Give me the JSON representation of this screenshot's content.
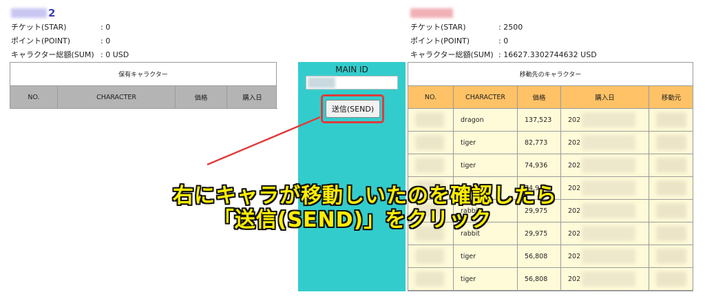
{
  "left_account": {
    "name_suffix": "2",
    "rows": [
      {
        "label": "チケット(STAR)",
        "value": ": 0"
      },
      {
        "label": "ポイント(POINT)",
        "value": ": 0"
      },
      {
        "label": "キャラクター総額(SUM)",
        "value": ": 0 USD"
      }
    ]
  },
  "right_account": {
    "rows": [
      {
        "label": "チケット(STAR)",
        "value": ": 2500"
      },
      {
        "label": "ポイント(POINT)",
        "value": ": 0"
      },
      {
        "label": "キャラクター総額(SUM)",
        "value": ": 16627.3302744632 USD"
      }
    ]
  },
  "left_table": {
    "title": "保有キャラクター",
    "headers": [
      "NO.",
      "CHARACTER",
      "価格",
      "購入日"
    ]
  },
  "middle": {
    "title": "MAIN ID",
    "send_label": "送信(SEND)"
  },
  "right_table": {
    "title": "移動先のキャラクター",
    "headers": [
      "NO.",
      "CHARACTER",
      "価格",
      "購入日",
      "移動元"
    ],
    "rows": [
      {
        "character": "dragon",
        "price": "137,523",
        "date_prefix": "202"
      },
      {
        "character": "tiger",
        "price": "82,773",
        "date_prefix": "202"
      },
      {
        "character": "tiger",
        "price": "74,936",
        "date_prefix": "202"
      },
      {
        "character": "tiger",
        "price": "74,936",
        "date_prefix": "202"
      },
      {
        "character": "rabbit",
        "price": "29,975",
        "date_prefix": "202"
      },
      {
        "character": "rabbit",
        "price": "29,975",
        "date_prefix": "202"
      },
      {
        "character": "tiger",
        "price": "56,808",
        "date_prefix": "202"
      },
      {
        "character": "tiger",
        "price": "56,808",
        "date_prefix": "202"
      }
    ]
  },
  "caption": {
    "line1": "右にキャラが移動しいたのを確認したら",
    "line2": "「送信(SEND)」をクリック"
  },
  "colors": {
    "teal_panel": "#33cccc",
    "header_orange": "#ffc266",
    "row_cream": "#fffbd9",
    "header_gray": "#b4b4b4",
    "highlight_red": "#e23a3a",
    "caption_yellow": "#ffee00"
  }
}
